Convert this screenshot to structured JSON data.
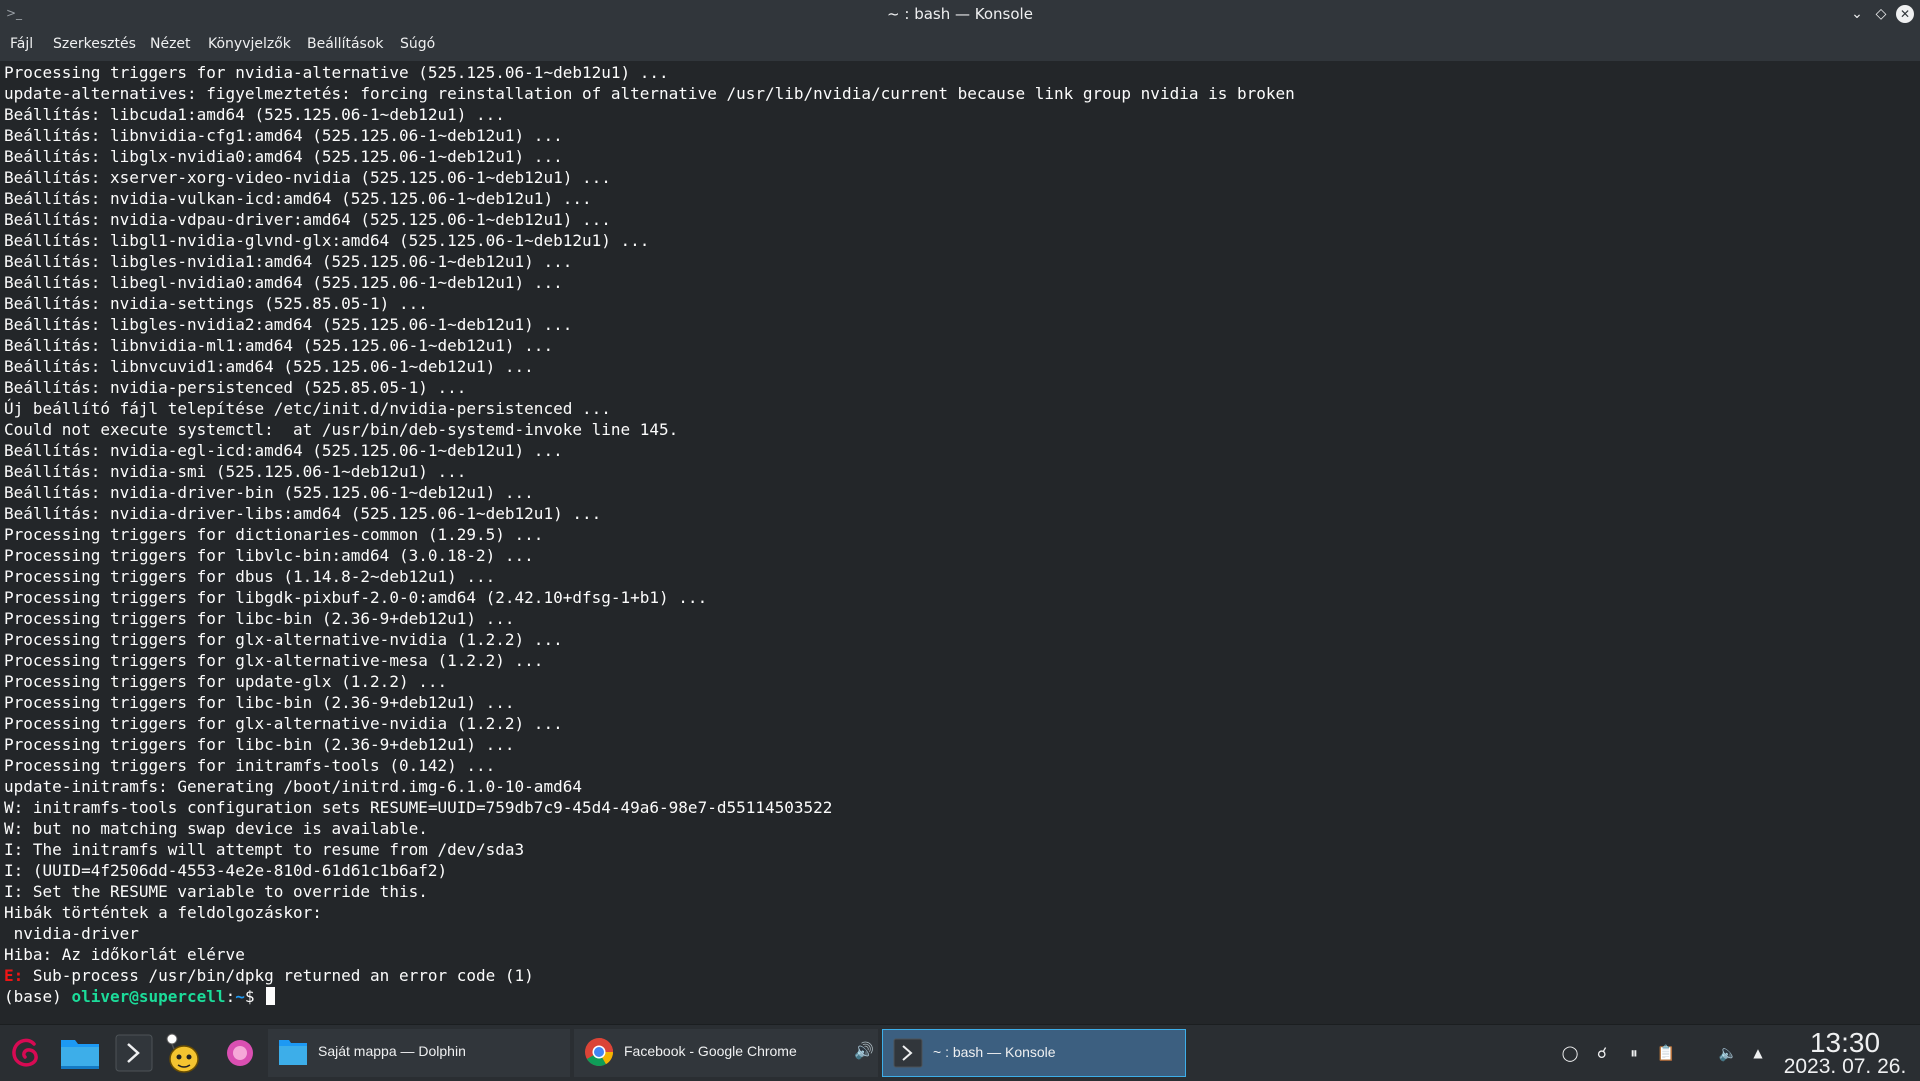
{
  "window": {
    "title": "~ : bash — Konsole",
    "menu": [
      "Fájl",
      "Szerkesztés",
      "Nézet",
      "Könyvjelzők",
      "Beállítások",
      "Súgó"
    ]
  },
  "terminal": {
    "lines": [
      "Processing triggers for nvidia-alternative (525.125.06-1~deb12u1) ...",
      "update-alternatives: figyelmeztetés: forcing reinstallation of alternative /usr/lib/nvidia/current because link group nvidia is broken",
      "Beállítás: libcuda1:amd64 (525.125.06-1~deb12u1) ...",
      "Beállítás: libnvidia-cfg1:amd64 (525.125.06-1~deb12u1) ...",
      "Beállítás: libglx-nvidia0:amd64 (525.125.06-1~deb12u1) ...",
      "Beállítás: xserver-xorg-video-nvidia (525.125.06-1~deb12u1) ...",
      "Beállítás: nvidia-vulkan-icd:amd64 (525.125.06-1~deb12u1) ...",
      "Beállítás: nvidia-vdpau-driver:amd64 (525.125.06-1~deb12u1) ...",
      "Beállítás: libgl1-nvidia-glvnd-glx:amd64 (525.125.06-1~deb12u1) ...",
      "Beállítás: libgles-nvidia1:amd64 (525.125.06-1~deb12u1) ...",
      "Beállítás: libegl-nvidia0:amd64 (525.125.06-1~deb12u1) ...",
      "Beállítás: nvidia-settings (525.85.05-1) ...",
      "Beállítás: libgles-nvidia2:amd64 (525.125.06-1~deb12u1) ...",
      "Beállítás: libnvidia-ml1:amd64 (525.125.06-1~deb12u1) ...",
      "Beállítás: libnvcuvid1:amd64 (525.125.06-1~deb12u1) ...",
      "Beállítás: nvidia-persistenced (525.85.05-1) ...",
      "Új beállító fájl telepítése /etc/init.d/nvidia-persistenced ...",
      "Could not execute systemctl:  at /usr/bin/deb-systemd-invoke line 145.",
      "Beállítás: nvidia-egl-icd:amd64 (525.125.06-1~deb12u1) ...",
      "Beállítás: nvidia-smi (525.125.06-1~deb12u1) ...",
      "Beállítás: nvidia-driver-bin (525.125.06-1~deb12u1) ...",
      "Beállítás: nvidia-driver-libs:amd64 (525.125.06-1~deb12u1) ...",
      "Processing triggers for dictionaries-common (1.29.5) ...",
      "Processing triggers for libvlc-bin:amd64 (3.0.18-2) ...",
      "Processing triggers for dbus (1.14.8-2~deb12u1) ...",
      "Processing triggers for libgdk-pixbuf-2.0-0:amd64 (2.42.10+dfsg-1+b1) ...",
      "Processing triggers for libc-bin (2.36-9+deb12u1) ...",
      "Processing triggers for glx-alternative-nvidia (1.2.2) ...",
      "Processing triggers for glx-alternative-mesa (1.2.2) ...",
      "Processing triggers for update-glx (1.2.2) ...",
      "Processing triggers for libc-bin (2.36-9+deb12u1) ...",
      "Processing triggers for glx-alternative-nvidia (1.2.2) ...",
      "Processing triggers for libc-bin (2.36-9+deb12u1) ...",
      "Processing triggers for initramfs-tools (0.142) ...",
      "update-initramfs: Generating /boot/initrd.img-6.1.0-10-amd64",
      "W: initramfs-tools configuration sets RESUME=UUID=759db7c9-45d4-49a6-98e7-d55114503522",
      "W: but no matching swap device is available.",
      "I: The initramfs will attempt to resume from /dev/sda3",
      "I: (UUID=4f2506dd-4553-4e2e-810d-61d61c1b6af2)",
      "I: Set the RESUME variable to override this.",
      "Hibák történtek a feldolgozáskor:",
      " nvidia-driver",
      "Hiba: Az időkorlát elérve"
    ],
    "error_line": {
      "prefix": "E:",
      "text": " Sub-process /usr/bin/dpkg returned an error code (1)"
    },
    "prompt": {
      "env": "(base) ",
      "user_host": "oliver@supercell",
      "sep": ":",
      "path": "~",
      "symbol": "$ "
    }
  },
  "taskbar": {
    "tasks": [
      {
        "label": "Saját mappa — Dolphin",
        "icon": "folder-icon"
      },
      {
        "label": "Facebook - Google Chrome",
        "icon": "chrome-icon",
        "audio": true
      },
      {
        "label": "~ : bash — Konsole",
        "icon": "terminal-icon",
        "active": true
      }
    ],
    "clock": {
      "time": "13:30",
      "date": "2023. 07. 26."
    }
  },
  "colors": {
    "terminal_bg": "#232629",
    "user_green": "#1cdc9a",
    "path_blue": "#1d99f3",
    "error_red": "#ed1515",
    "active_task": "#3c5f80"
  }
}
